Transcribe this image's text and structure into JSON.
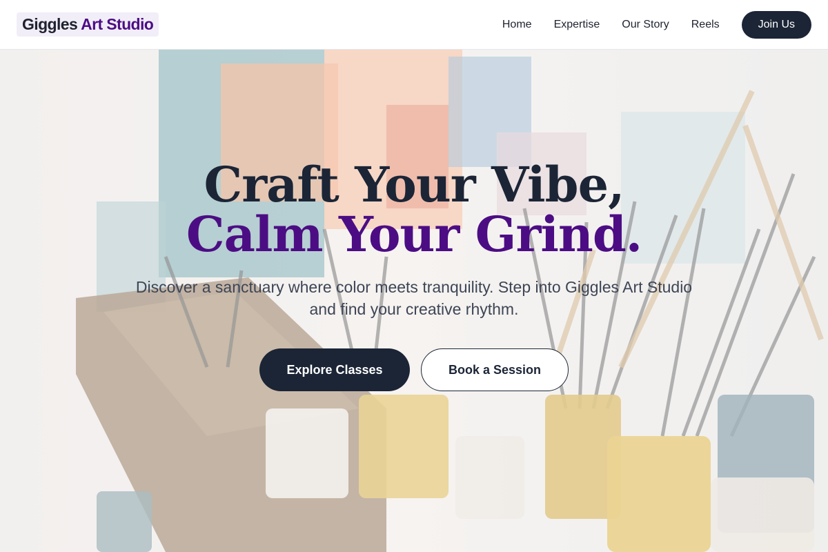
{
  "header": {
    "logo_part1": "Giggles",
    "logo_part2": "Art Studio",
    "nav": [
      "Home",
      "Expertise",
      "Our Story",
      "Reels"
    ],
    "join_label": "Join Us"
  },
  "hero": {
    "title_line1": "Craft Your Vibe,",
    "title_line2": "Calm Your Grind.",
    "subtitle": "Discover a sanctuary where color meets tranquility. Step into Giggles Art Studio and find your creative rhythm.",
    "primary_button": "Explore Classes",
    "secondary_button": "Book a Session",
    "background_image": "art-studio-paint-brushes-photo"
  },
  "colors": {
    "accent": "#4c0d84",
    "primary": "#1b2536"
  }
}
